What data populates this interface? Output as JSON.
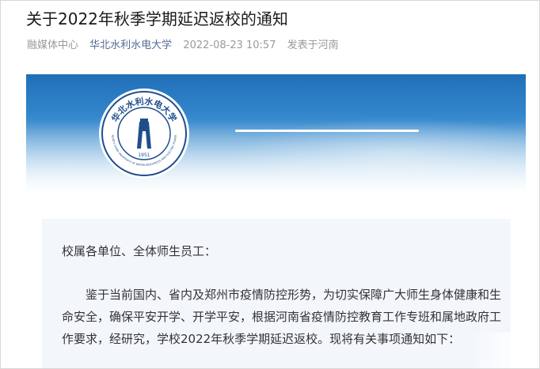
{
  "article": {
    "title": "关于2022年秋季学期延迟返校的通知",
    "meta": {
      "source": "融媒体中心",
      "account": "华北水利水电大学",
      "datetime": "2022-08-23 10:57",
      "location": "发表于河南"
    }
  },
  "banner": {
    "logo": {
      "arc_text": "华北水利水电大学",
      "english_text": "NORTH CHINA UNIVERSITY OF WATER RESOURCES AND ELECTRIC POWER",
      "year": "1951"
    }
  },
  "body": {
    "salutation": "校属各单位、全体师生员工：",
    "paragraph": "鉴于当前国内、省内及郑州市疫情防控形势，为切实保障广大师生身体健康和生命安全，确保平安开学、开学平安，根据河南省疫情防控教育工作专班和属地政府工作要求，经研究，学校2022年秋季学期延迟返校。现将有关事项通知如下："
  }
}
